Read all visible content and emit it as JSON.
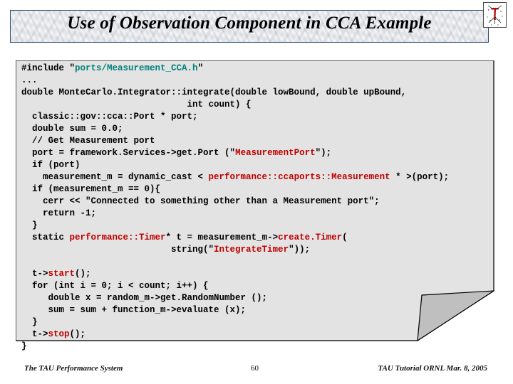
{
  "slide": {
    "title": "Use of Observation Component in CCA Example",
    "logo_name": "tau-logo",
    "accent_colors": {
      "title_border": "#2f4f6f",
      "code_background": "#e3e3e3",
      "string_red": "#c00000",
      "header_teal": "#00807a"
    }
  },
  "code": {
    "language": "C++",
    "lines": [
      [
        {
          "t": "#include ",
          "c": "black"
        },
        {
          "t": "\"",
          "c": "black"
        },
        {
          "t": "ports/Measurement_CCA.h",
          "c": "teal"
        },
        {
          "t": "\"",
          "c": "black"
        }
      ],
      [
        {
          "t": "...",
          "c": "black"
        }
      ],
      [
        {
          "t": "double MonteCarlo.Integrator::integrate(double lowBound, double upBound,",
          "c": "black"
        }
      ],
      [
        {
          "t": "                               int count) {",
          "c": "black"
        }
      ],
      [
        {
          "t": "  classic::gov::cca::Port * port;",
          "c": "black"
        }
      ],
      [
        {
          "t": "  double sum = 0.0;",
          "c": "black"
        }
      ],
      [
        {
          "t": "  // Get Measurement port",
          "c": "black"
        }
      ],
      [
        {
          "t": "  port = framework.Services->get.Port (\"",
          "c": "black"
        },
        {
          "t": "MeasurementPort",
          "c": "red"
        },
        {
          "t": "\");",
          "c": "black"
        }
      ],
      [
        {
          "t": "  if (port)",
          "c": "black"
        }
      ],
      [
        {
          "t": "    measurement_m = dynamic_cast < ",
          "c": "black"
        },
        {
          "t": "performance::ccaports::Measurement",
          "c": "red"
        },
        {
          "t": " * >(port);",
          "c": "black"
        }
      ],
      [
        {
          "t": "  if (measurement_m == 0){",
          "c": "black"
        }
      ],
      [
        {
          "t": "    cerr << \"Connected to something other than a Measurement port\";",
          "c": "black"
        }
      ],
      [
        {
          "t": "    return -1;",
          "c": "black"
        }
      ],
      [
        {
          "t": "  }",
          "c": "black"
        }
      ],
      [
        {
          "t": "  static ",
          "c": "black"
        },
        {
          "t": "performance::Timer",
          "c": "red"
        },
        {
          "t": "* t = measurement_m->",
          "c": "black"
        },
        {
          "t": "create.Timer",
          "c": "red"
        },
        {
          "t": "(",
          "c": "black"
        }
      ],
      [
        {
          "t": "                            string(\"",
          "c": "black"
        },
        {
          "t": "IntegrateTimer",
          "c": "red"
        },
        {
          "t": "\"));",
          "c": "black"
        }
      ],
      [
        {
          "t": "",
          "c": "black"
        }
      ],
      [
        {
          "t": "  t->",
          "c": "black"
        },
        {
          "t": "start",
          "c": "red"
        },
        {
          "t": "();",
          "c": "black"
        }
      ],
      [
        {
          "t": "  for (int i = 0; i < count; i++) {",
          "c": "black"
        }
      ],
      [
        {
          "t": "     double x = random_m->get.RandomNumber ();",
          "c": "black"
        }
      ],
      [
        {
          "t": "     sum = sum + function_m->evaluate (x);",
          "c": "black"
        }
      ],
      [
        {
          "t": "  }",
          "c": "black"
        }
      ],
      [
        {
          "t": "  t->",
          "c": "black"
        },
        {
          "t": "stop",
          "c": "red"
        },
        {
          "t": "();",
          "c": "black"
        }
      ],
      [
        {
          "t": "}",
          "c": "black"
        }
      ]
    ]
  },
  "footer": {
    "left": "The TAU Performance System",
    "page_number": "60",
    "right": "TAU Tutorial ORNL Mar. 8, 2005"
  }
}
